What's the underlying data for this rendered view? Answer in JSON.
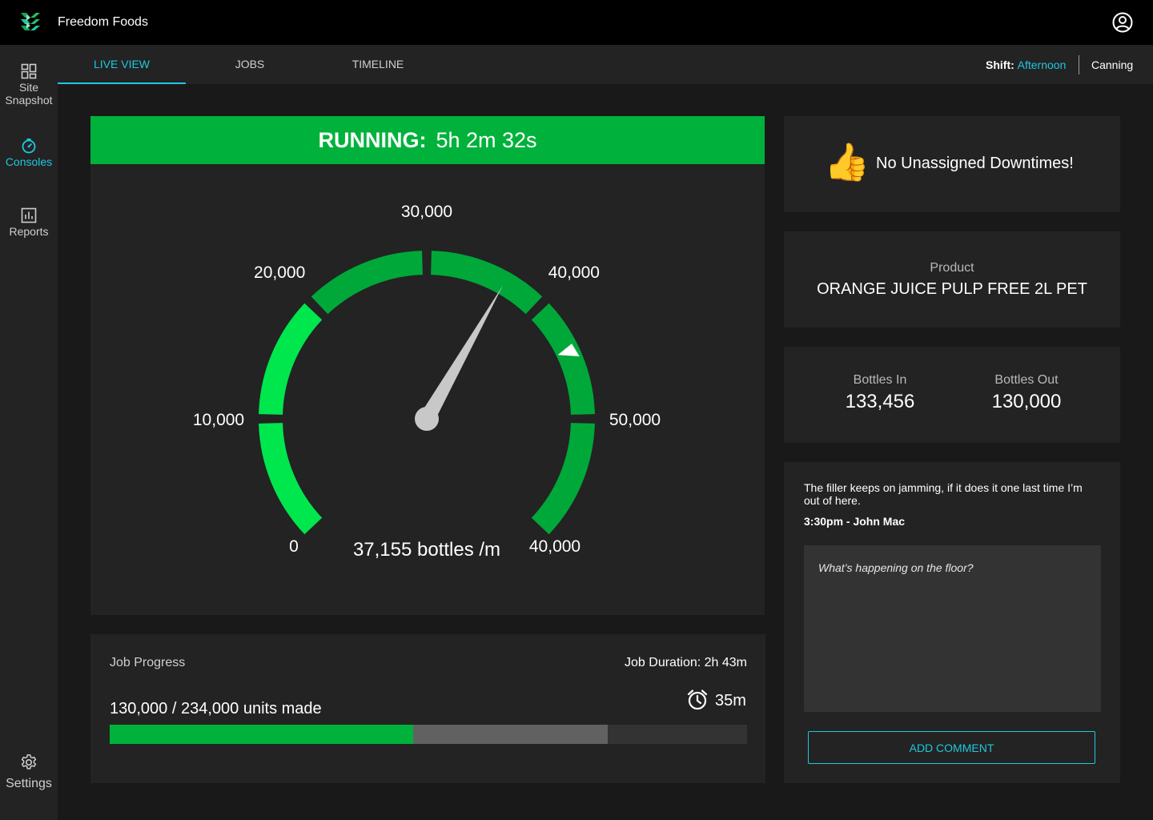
{
  "app": {
    "title": "Freedom Foods"
  },
  "sidebar": {
    "items": [
      {
        "label": "Site\nSnapshot",
        "icon": "grid-icon",
        "active": false
      },
      {
        "label": "Consoles",
        "icon": "dial-icon",
        "active": true
      },
      {
        "label": "Reports",
        "icon": "bar-chart-icon",
        "active": false
      }
    ],
    "settings_label": "Settings"
  },
  "tabs": [
    {
      "label": "LIVE VIEW",
      "active": true
    },
    {
      "label": "JOBS",
      "active": false
    },
    {
      "label": "TIMELINE",
      "active": false
    }
  ],
  "shift": {
    "label": "Shift:",
    "value": "Afternoon"
  },
  "site": "Canning",
  "status": {
    "label": "RUNNING:",
    "duration": "5h 2m 32s",
    "color": "#00b23c"
  },
  "gauge": {
    "tick_labels": [
      "0",
      "10,000",
      "20,000",
      "30,000",
      "40,000",
      "50,000",
      "40,000"
    ],
    "needle_fraction": 0.61,
    "target_fraction": 0.735,
    "readout": "37,155 bottles /m",
    "colors": {
      "low": "#00e64d",
      "high": "#00a83a",
      "needle": "#c8c8c8"
    }
  },
  "job_progress": {
    "title": "Job Progress",
    "duration": "Job Duration: 2h 43m",
    "units": "130,000 / 234,000 units made",
    "remaining": "35m",
    "made_fraction": 0.4766,
    "expected_fraction": 0.7814
  },
  "downtime": {
    "icon": "thumbs-up-icon",
    "text": "No Unassigned Downtimes!"
  },
  "product": {
    "label": "Product",
    "name": "ORANGE JUICE PULP FREE 2L PET"
  },
  "bottles": {
    "in_label": "Bottles In",
    "in_value": "133,456",
    "out_label": "Bottles Out",
    "out_value": "130,000"
  },
  "comments": {
    "latest_text": "The filler keeps on jamming, if it does it one last time I’m out of here.",
    "latest_meta": "3:30pm - John Mac",
    "placeholder": "What’s happening on the floor?",
    "button_label": "ADD COMMENT"
  },
  "accent_color": "#1ec8e0"
}
